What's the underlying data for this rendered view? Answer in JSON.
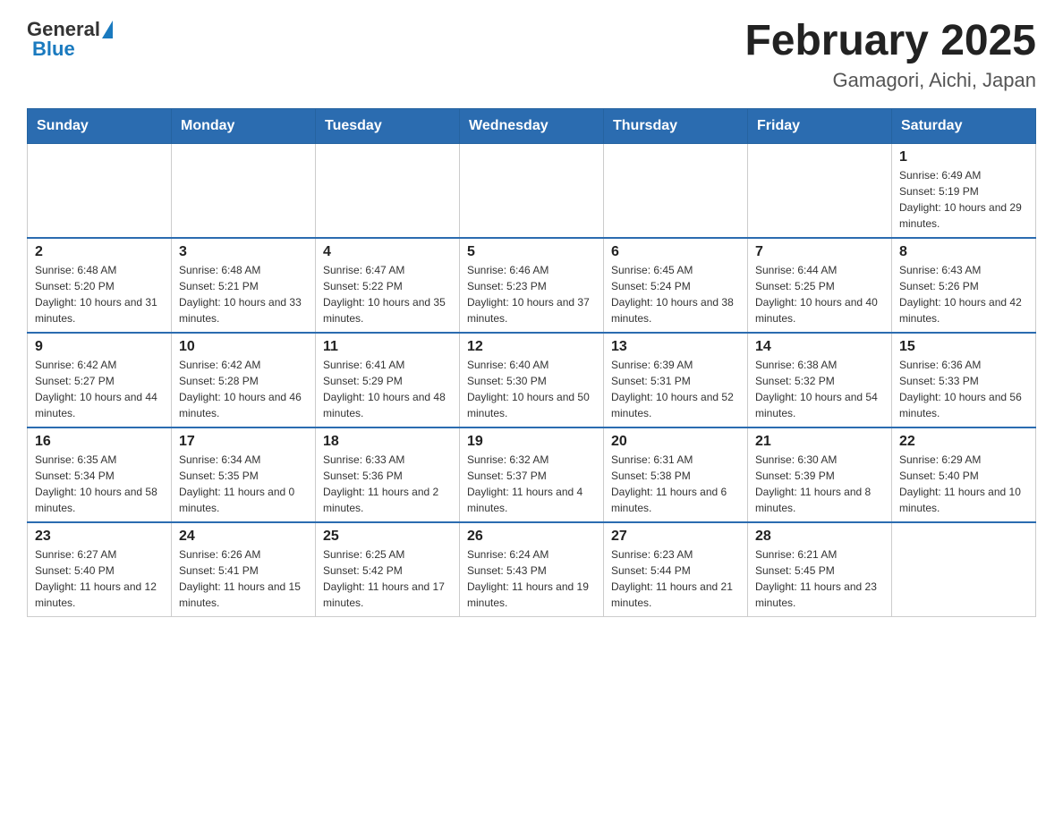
{
  "header": {
    "logo": {
      "general": "General",
      "blue": "Blue"
    },
    "title": "February 2025",
    "location": "Gamagori, Aichi, Japan"
  },
  "weekdays": [
    "Sunday",
    "Monday",
    "Tuesday",
    "Wednesday",
    "Thursday",
    "Friday",
    "Saturday"
  ],
  "weeks": [
    [
      {
        "num": "",
        "info": ""
      },
      {
        "num": "",
        "info": ""
      },
      {
        "num": "",
        "info": ""
      },
      {
        "num": "",
        "info": ""
      },
      {
        "num": "",
        "info": ""
      },
      {
        "num": "",
        "info": ""
      },
      {
        "num": "1",
        "info": "Sunrise: 6:49 AM\nSunset: 5:19 PM\nDaylight: 10 hours and 29 minutes."
      }
    ],
    [
      {
        "num": "2",
        "info": "Sunrise: 6:48 AM\nSunset: 5:20 PM\nDaylight: 10 hours and 31 minutes."
      },
      {
        "num": "3",
        "info": "Sunrise: 6:48 AM\nSunset: 5:21 PM\nDaylight: 10 hours and 33 minutes."
      },
      {
        "num": "4",
        "info": "Sunrise: 6:47 AM\nSunset: 5:22 PM\nDaylight: 10 hours and 35 minutes."
      },
      {
        "num": "5",
        "info": "Sunrise: 6:46 AM\nSunset: 5:23 PM\nDaylight: 10 hours and 37 minutes."
      },
      {
        "num": "6",
        "info": "Sunrise: 6:45 AM\nSunset: 5:24 PM\nDaylight: 10 hours and 38 minutes."
      },
      {
        "num": "7",
        "info": "Sunrise: 6:44 AM\nSunset: 5:25 PM\nDaylight: 10 hours and 40 minutes."
      },
      {
        "num": "8",
        "info": "Sunrise: 6:43 AM\nSunset: 5:26 PM\nDaylight: 10 hours and 42 minutes."
      }
    ],
    [
      {
        "num": "9",
        "info": "Sunrise: 6:42 AM\nSunset: 5:27 PM\nDaylight: 10 hours and 44 minutes."
      },
      {
        "num": "10",
        "info": "Sunrise: 6:42 AM\nSunset: 5:28 PM\nDaylight: 10 hours and 46 minutes."
      },
      {
        "num": "11",
        "info": "Sunrise: 6:41 AM\nSunset: 5:29 PM\nDaylight: 10 hours and 48 minutes."
      },
      {
        "num": "12",
        "info": "Sunrise: 6:40 AM\nSunset: 5:30 PM\nDaylight: 10 hours and 50 minutes."
      },
      {
        "num": "13",
        "info": "Sunrise: 6:39 AM\nSunset: 5:31 PM\nDaylight: 10 hours and 52 minutes."
      },
      {
        "num": "14",
        "info": "Sunrise: 6:38 AM\nSunset: 5:32 PM\nDaylight: 10 hours and 54 minutes."
      },
      {
        "num": "15",
        "info": "Sunrise: 6:36 AM\nSunset: 5:33 PM\nDaylight: 10 hours and 56 minutes."
      }
    ],
    [
      {
        "num": "16",
        "info": "Sunrise: 6:35 AM\nSunset: 5:34 PM\nDaylight: 10 hours and 58 minutes."
      },
      {
        "num": "17",
        "info": "Sunrise: 6:34 AM\nSunset: 5:35 PM\nDaylight: 11 hours and 0 minutes."
      },
      {
        "num": "18",
        "info": "Sunrise: 6:33 AM\nSunset: 5:36 PM\nDaylight: 11 hours and 2 minutes."
      },
      {
        "num": "19",
        "info": "Sunrise: 6:32 AM\nSunset: 5:37 PM\nDaylight: 11 hours and 4 minutes."
      },
      {
        "num": "20",
        "info": "Sunrise: 6:31 AM\nSunset: 5:38 PM\nDaylight: 11 hours and 6 minutes."
      },
      {
        "num": "21",
        "info": "Sunrise: 6:30 AM\nSunset: 5:39 PM\nDaylight: 11 hours and 8 minutes."
      },
      {
        "num": "22",
        "info": "Sunrise: 6:29 AM\nSunset: 5:40 PM\nDaylight: 11 hours and 10 minutes."
      }
    ],
    [
      {
        "num": "23",
        "info": "Sunrise: 6:27 AM\nSunset: 5:40 PM\nDaylight: 11 hours and 12 minutes."
      },
      {
        "num": "24",
        "info": "Sunrise: 6:26 AM\nSunset: 5:41 PM\nDaylight: 11 hours and 15 minutes."
      },
      {
        "num": "25",
        "info": "Sunrise: 6:25 AM\nSunset: 5:42 PM\nDaylight: 11 hours and 17 minutes."
      },
      {
        "num": "26",
        "info": "Sunrise: 6:24 AM\nSunset: 5:43 PM\nDaylight: 11 hours and 19 minutes."
      },
      {
        "num": "27",
        "info": "Sunrise: 6:23 AM\nSunset: 5:44 PM\nDaylight: 11 hours and 21 minutes."
      },
      {
        "num": "28",
        "info": "Sunrise: 6:21 AM\nSunset: 5:45 PM\nDaylight: 11 hours and 23 minutes."
      },
      {
        "num": "",
        "info": ""
      }
    ]
  ]
}
